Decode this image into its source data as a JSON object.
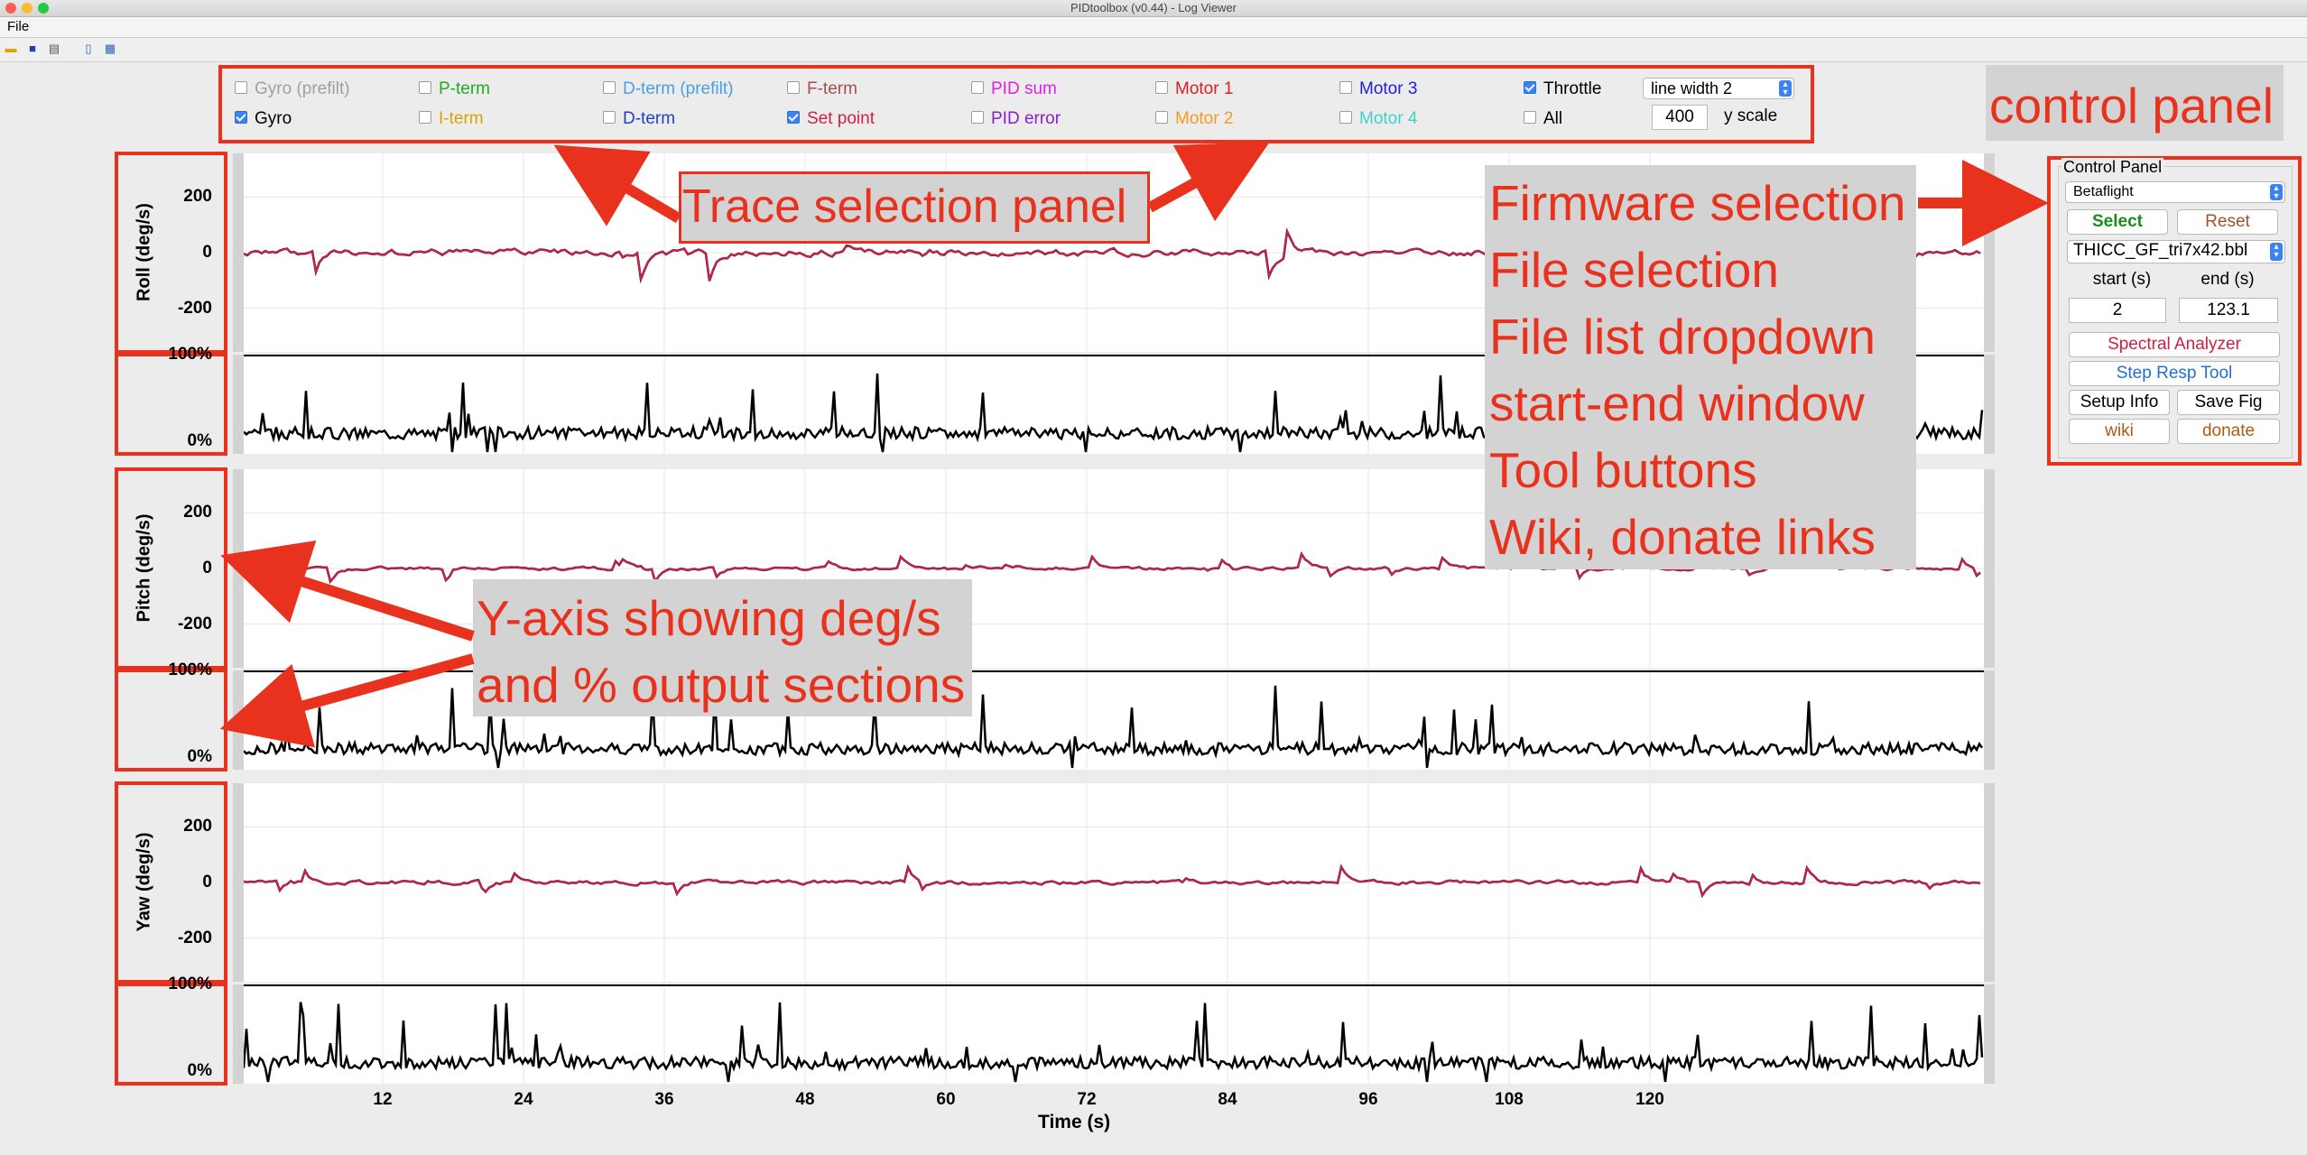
{
  "window": {
    "title": "PIDtoolbox (v0.44) - Log Viewer"
  },
  "menu": {
    "file": "File"
  },
  "traces": [
    {
      "label": "Gyro (prefilt)",
      "checked": false,
      "color": "#a0a0a0"
    },
    {
      "label": "Gyro",
      "checked": true,
      "color": "#000000"
    },
    {
      "label": "P-term",
      "checked": false,
      "color": "#22aa22"
    },
    {
      "label": "I-term",
      "checked": false,
      "color": "#d9a400"
    },
    {
      "label": "D-term (prefilt)",
      "checked": false,
      "color": "#4a9fe0"
    },
    {
      "label": "D-term",
      "checked": false,
      "color": "#2040d0"
    },
    {
      "label": "F-term",
      "checked": false,
      "color": "#a05050"
    },
    {
      "label": "Set point",
      "checked": true,
      "color": "#d0204a"
    },
    {
      "label": "PID sum",
      "checked": false,
      "color": "#e020e0"
    },
    {
      "label": "PID error",
      "checked": false,
      "color": "#8a20c8"
    },
    {
      "label": "Motor 1",
      "checked": false,
      "color": "#e02020"
    },
    {
      "label": "Motor 2",
      "checked": false,
      "color": "#f59a20"
    },
    {
      "label": "Motor 3",
      "checked": false,
      "color": "#2020e0"
    },
    {
      "label": "Motor 4",
      "checked": false,
      "color": "#40d0c8"
    },
    {
      "label": "Throttle",
      "checked": true,
      "color": "#000000"
    },
    {
      "label": "All",
      "checked": false,
      "color": "#000000"
    }
  ],
  "linewidth": {
    "selected": "line width 2"
  },
  "yscale": {
    "value": "400",
    "label": "y scale"
  },
  "control_panel": {
    "title": "Control Panel",
    "firmware": "Betaflight",
    "select": "Select",
    "reset": "Reset",
    "file": "THICC_GF_tri7x42.bbl",
    "start_label": "start (s)",
    "end_label": "end (s)",
    "start_value": "2",
    "end_value": "123.1",
    "spectral": "Spectral Analyzer",
    "step": "Step Resp Tool",
    "setup": "Setup Info",
    "save": "Save Fig",
    "wiki": "wiki",
    "donate": "donate"
  },
  "colors": {
    "annotation_red": "#e8321e",
    "trace_red": "#d0204a",
    "select_green": "#1a8c1a",
    "reset_brown": "#a0522d",
    "spectral_red": "#d02040",
    "step_blue": "#2070d0",
    "link_brown": "#b05a10"
  },
  "plots": {
    "roll_label": "Roll (deg/s)",
    "pitch_label": "Pitch (deg/s)",
    "yaw_label": "Yaw (deg/s)",
    "deg_ticks": [
      "200",
      "0",
      "-200"
    ],
    "pct_ticks": [
      "100%",
      "0%"
    ],
    "x_ticks": [
      "12",
      "24",
      "36",
      "48",
      "60",
      "72",
      "84",
      "96",
      "108",
      "120"
    ],
    "x_label": "Time (s)"
  },
  "annotations": {
    "control_panel": "control panel",
    "trace_panel": "Trace selection panel",
    "cp_list": [
      "Firmware selection",
      "File selection",
      "File list dropdown",
      "start-end window",
      "Tool buttons",
      "Wiki, donate links"
    ],
    "yaxis_1": "Y-axis showing deg/s",
    "yaxis_2": "and % output sections"
  }
}
